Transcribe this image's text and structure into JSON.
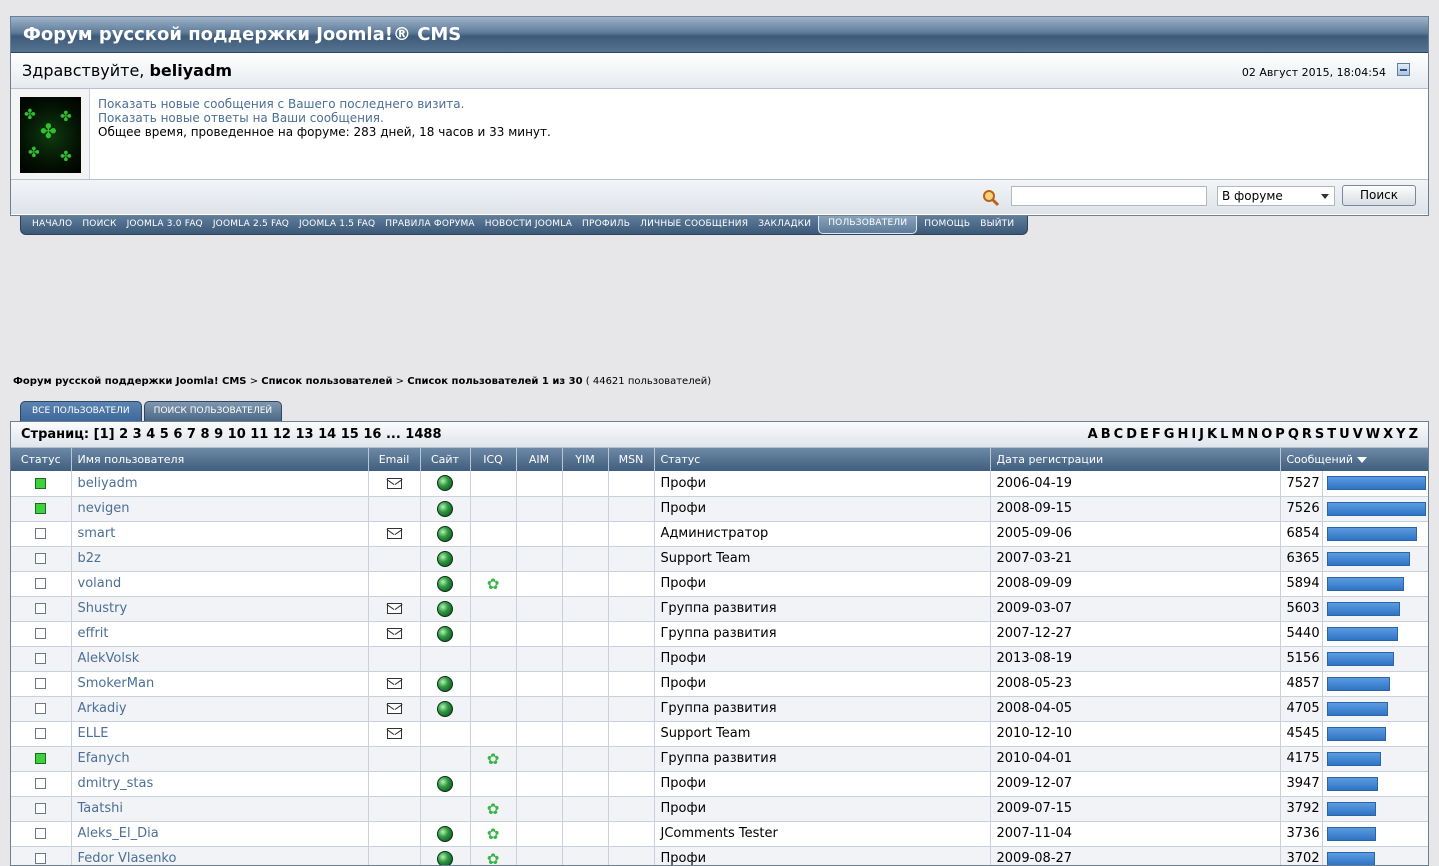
{
  "forum": {
    "title": "Форум русской поддержки Joomla!® CMS",
    "greeting": "Здравствуйте,",
    "username": "beliyadm",
    "datetime": "02 Август 2015, 18:04:54"
  },
  "profile": {
    "link_new_posts": "Показать новые сообщения с Вашего последнего визита.",
    "link_new_replies": "Показать новые ответы на Ваши сообщения.",
    "time_online": "Общее время, проведенное на форуме: 283 дней, 18 часов и 33 минут."
  },
  "search": {
    "value": "",
    "scope": "В форуме",
    "button": "Поиск"
  },
  "nav": [
    "НАЧАЛО",
    "ПОИСК",
    "JOOMLA 3.0 FAQ",
    "JOOMLA 2.5 FAQ",
    "JOOMLA 1.5 FAQ",
    "ПРАВИЛА ФОРУМА",
    "НОВОСТИ JOOMLA",
    "ПРОФИЛЬ",
    "ЛИЧНЫЕ СООБЩЕНИЯ",
    "ЗАКЛАДКИ",
    "ПОЛЬЗОВАТЕЛИ",
    "ПОМОЩЬ",
    "ВЫЙТИ"
  ],
  "nav_active": "ПОЛЬЗОВАТЕЛИ",
  "breadcrumb": {
    "forum": "Форум русской поддержки Joomla! CMS",
    "sep": ">",
    "userlist": "Список пользователей",
    "current": "Список пользователей 1 из 30",
    "count": "( 44621 пользователей)"
  },
  "tabs": [
    "ВСЕ ПОЛЬЗОВАТЕЛИ",
    "ПОИСК ПОЛЬЗОВАТЕЛЕЙ"
  ],
  "pager": {
    "label": "Страниц:",
    "pages": "[1] 2 3 4 5 6 7 8 9 10 11 12 13 14 15 16 ... 1488"
  },
  "letters": [
    "A",
    "B",
    "C",
    "D",
    "E",
    "F",
    "G",
    "H",
    "I",
    "J",
    "K",
    "L",
    "M",
    "N",
    "O",
    "P",
    "Q",
    "R",
    "S",
    "T",
    "U",
    "V",
    "W",
    "X",
    "Y",
    "Z"
  ],
  "columns": {
    "status": "Статус",
    "name": "Имя пользователя",
    "email": "Email",
    "site": "Сайт",
    "icq": "ICQ",
    "aim": "AIM",
    "yim": "YIM",
    "msn": "MSN",
    "group": "Статус",
    "registered": "Дата регистрации",
    "posts": "Сообщений"
  },
  "icons": {
    "online": "status-online-icon",
    "offline": "status-offline-icon",
    "email": "envelope-icon",
    "site": "globe-icon",
    "icq": "icq-flower-icon",
    "sort": "sort-desc-icon"
  },
  "max_posts": 7527,
  "users": [
    {
      "online": true,
      "name": "beliyadm",
      "email": true,
      "site": true,
      "icq": false,
      "group": "Профи",
      "registered": "2006-04-19",
      "posts": 7527
    },
    {
      "online": true,
      "name": "nevigen",
      "email": false,
      "site": true,
      "icq": false,
      "group": "Профи",
      "registered": "2008-09-15",
      "posts": 7526
    },
    {
      "online": false,
      "name": "smart",
      "email": true,
      "site": true,
      "icq": false,
      "group": "Администратор",
      "registered": "2005-09-06",
      "posts": 6854
    },
    {
      "online": false,
      "name": "b2z",
      "email": false,
      "site": true,
      "icq": false,
      "group": "Support Team",
      "registered": "2007-03-21",
      "posts": 6365
    },
    {
      "online": false,
      "name": "voland",
      "email": false,
      "site": true,
      "icq": true,
      "group": "Профи",
      "registered": "2008-09-09",
      "posts": 5894
    },
    {
      "online": false,
      "name": "Shustry",
      "email": true,
      "site": true,
      "icq": false,
      "group": "Группа развития",
      "registered": "2009-03-07",
      "posts": 5603
    },
    {
      "online": false,
      "name": "effrit",
      "email": true,
      "site": true,
      "icq": false,
      "group": "Группа развития",
      "registered": "2007-12-27",
      "posts": 5440
    },
    {
      "online": false,
      "name": "AlekVolsk",
      "email": false,
      "site": false,
      "icq": false,
      "group": "Профи",
      "registered": "2013-08-19",
      "posts": 5156
    },
    {
      "online": false,
      "name": "SmokerMan",
      "email": true,
      "site": true,
      "icq": false,
      "group": "Профи",
      "registered": "2008-05-23",
      "posts": 4857
    },
    {
      "online": false,
      "name": "Arkadiy",
      "email": true,
      "site": true,
      "icq": false,
      "group": "Группа развития",
      "registered": "2008-04-05",
      "posts": 4705
    },
    {
      "online": false,
      "name": "ELLE",
      "email": true,
      "site": false,
      "icq": false,
      "group": "Support Team",
      "registered": "2010-12-10",
      "posts": 4545
    },
    {
      "online": true,
      "name": "Efanych",
      "email": false,
      "site": false,
      "icq": true,
      "group": "Группа развития",
      "registered": "2010-04-01",
      "posts": 4175
    },
    {
      "online": false,
      "name": "dmitry_stas",
      "email": false,
      "site": true,
      "icq": false,
      "group": "Профи",
      "registered": "2009-12-07",
      "posts": 3947
    },
    {
      "online": false,
      "name": "Taatshi",
      "email": false,
      "site": false,
      "icq": true,
      "group": "Профи",
      "registered": "2009-07-15",
      "posts": 3792
    },
    {
      "online": false,
      "name": "Aleks_El_Dia",
      "email": false,
      "site": true,
      "icq": true,
      "group": "JComments Tester",
      "registered": "2007-11-04",
      "posts": 3736
    },
    {
      "online": false,
      "name": "Fedor Vlasenko",
      "email": false,
      "site": true,
      "icq": true,
      "group": "Профи",
      "registered": "2009-08-27",
      "posts": 3702
    }
  ]
}
